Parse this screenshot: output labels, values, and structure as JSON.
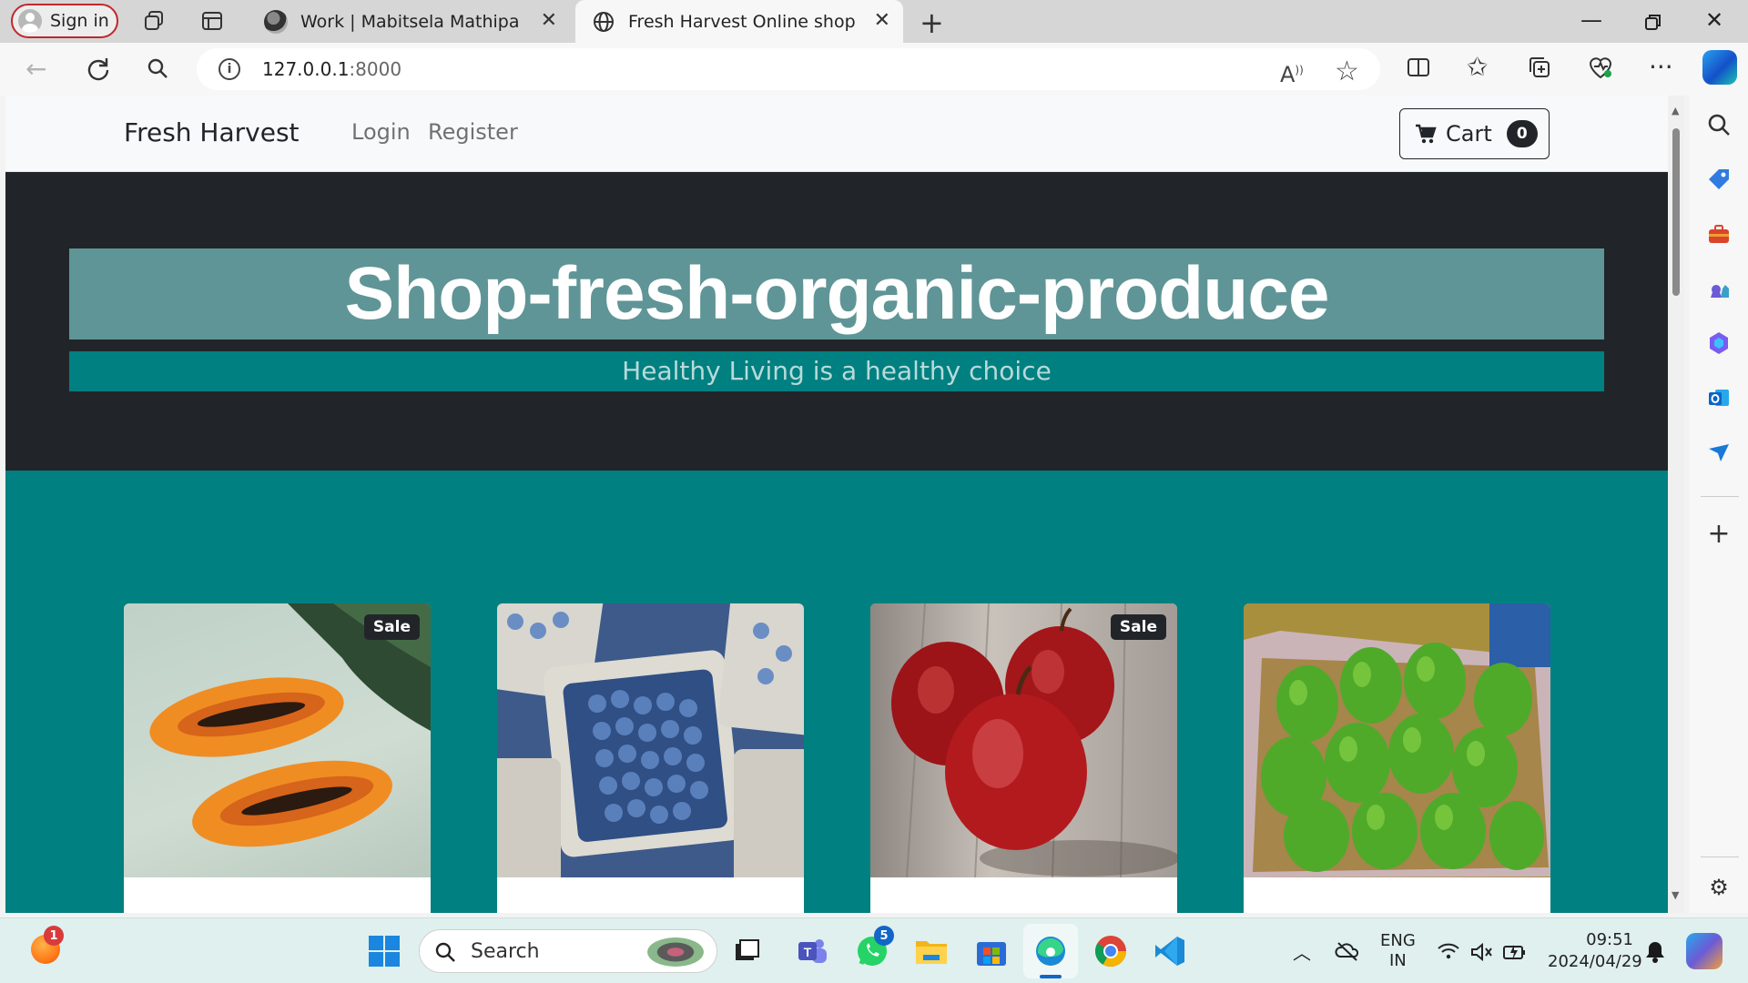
{
  "browser": {
    "signin_label": "Sign in",
    "tabs": [
      {
        "title": "Work | Mabitsela Mathipa"
      },
      {
        "title": "Fresh Harvest Online shop"
      }
    ],
    "address": {
      "host": "127.0.0.1",
      "port": ":8000"
    }
  },
  "site": {
    "brand": "Fresh Harvest",
    "nav": [
      {
        "label": "Login"
      },
      {
        "label": "Register"
      }
    ],
    "cart": {
      "label": "Cart",
      "count": "0"
    },
    "hero": {
      "title": "Shop-fresh-organic-produce",
      "subtitle": "Healthy Living is a healthy choice"
    },
    "products": [
      {
        "image": "papaya",
        "badge": "Sale"
      },
      {
        "image": "blueberries",
        "badge": ""
      },
      {
        "image": "apples",
        "badge": "Sale"
      },
      {
        "image": "avocados",
        "badge": ""
      }
    ]
  },
  "taskbar": {
    "search_label": "Search",
    "notification_count": "1",
    "whatsapp_count": "5",
    "language": {
      "line1": "ENG",
      "line2": "IN"
    },
    "clock": {
      "time": "09:51",
      "date": "2024/04/29"
    }
  },
  "colors": {
    "hero_bg": "#212529",
    "hero_title_bg": "#5f9596",
    "teal": "#008080"
  }
}
